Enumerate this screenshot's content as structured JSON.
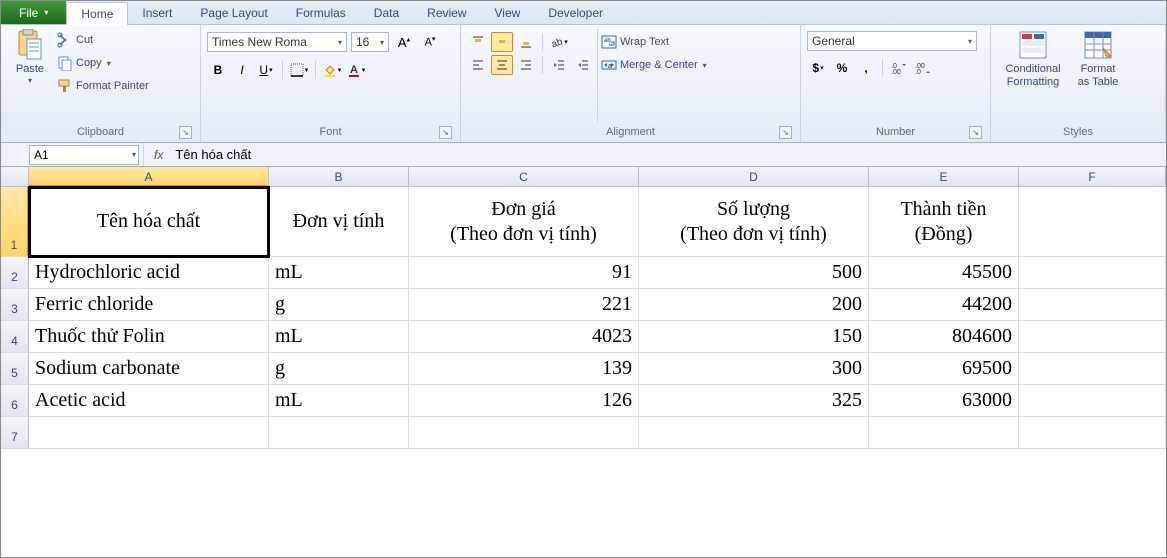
{
  "tabs": {
    "file": "File",
    "items": [
      "Home",
      "Insert",
      "Page Layout",
      "Formulas",
      "Data",
      "Review",
      "View",
      "Developer"
    ],
    "active": "Home"
  },
  "ribbon": {
    "clipboard": {
      "title": "Clipboard",
      "paste": "Paste",
      "cut": "Cut",
      "copy": "Copy",
      "copy_arrow": "▾",
      "format_painter": "Format Painter"
    },
    "font": {
      "title": "Font",
      "name": "Times New Roma",
      "size": "16"
    },
    "alignment": {
      "title": "Alignment",
      "wrap": "Wrap Text",
      "merge": "Merge & Center",
      "merge_arrow": "▾"
    },
    "number": {
      "title": "Number",
      "format": "General",
      "currency_arrow": "▾"
    },
    "styles": {
      "title": "Styles",
      "cond": "Conditional\nFormatting",
      "table": "Format\nas Table",
      "cond_arrow": "▾",
      "table_arrow": "▾"
    }
  },
  "formula_bar": {
    "name_box": "A1",
    "fx": "fx",
    "value": "Tên hóa chất"
  },
  "sheet": {
    "columns": [
      "A",
      "B",
      "C",
      "D",
      "E",
      "F"
    ],
    "selected_col": 0,
    "selected_row": 0,
    "headers": {
      "A": "Tên hóa chất",
      "B": "Đơn vị tính",
      "C": "Đơn giá\n(Theo đơn vị tính)",
      "D": "Số lượng\n(Theo đơn vị tính)",
      "E": "Thành tiền\n(Đồng)"
    },
    "rows": [
      {
        "A": "Hydrochloric acid",
        "B": "mL",
        "C": "91",
        "D": "500",
        "E": "45500"
      },
      {
        "A": "Ferric chloride",
        "B": "g",
        "C": "221",
        "D": "200",
        "E": "44200"
      },
      {
        "A": "Thuốc thử Folin",
        "B": "mL",
        "C": "4023",
        "D": "150",
        "E": "804600"
      },
      {
        "A": "Sodium carbonate",
        "B": "g",
        "C": "139",
        "D": "300",
        "E": "69500"
      },
      {
        "A": "Acetic acid",
        "B": "mL",
        "C": "126",
        "D": "325",
        "E": "63000"
      }
    ]
  },
  "chart_data": {
    "type": "table",
    "title": "",
    "columns": [
      "Tên hóa chất",
      "Đơn vị tính",
      "Đơn giá (Theo đơn vị tính)",
      "Số lượng (Theo đơn vị tính)",
      "Thành tiền (Đồng)"
    ],
    "rows": [
      [
        "Hydrochloric acid",
        "mL",
        91,
        500,
        45500
      ],
      [
        "Ferric chloride",
        "g",
        221,
        200,
        44200
      ],
      [
        "Thuốc thử Folin",
        "mL",
        4023,
        150,
        804600
      ],
      [
        "Sodium carbonate",
        "g",
        139,
        300,
        69500
      ],
      [
        "Acetic acid",
        "mL",
        126,
        325,
        63000
      ]
    ]
  }
}
